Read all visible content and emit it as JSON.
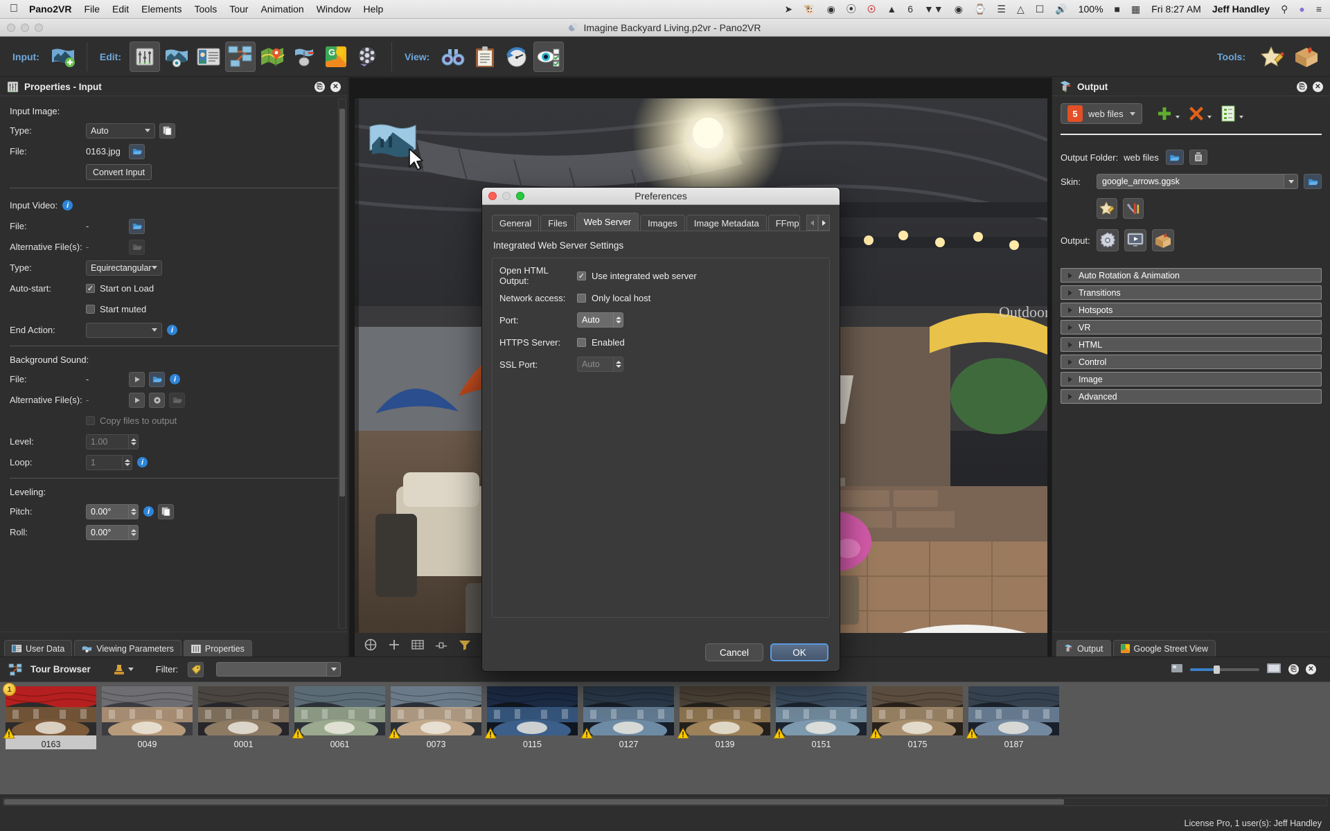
{
  "menubar": {
    "apple": "apple-logo",
    "app": "Pano2VR",
    "items": [
      "File",
      "Edit",
      "Elements",
      "Tools",
      "Tour",
      "Animation",
      "Window",
      "Help"
    ],
    "status_icons": [
      "location-arrow-icon",
      "evernote-icon",
      "skitch-icon",
      "dropbox-icon",
      "1password-icon",
      "adobe-icon",
      "textexpander-icon",
      "camera-icon",
      "timemachine-icon",
      "bluetooth-icon",
      "wifi-icon",
      "airplay-icon",
      "volume-icon"
    ],
    "adobe_count": "6",
    "battery_percent": "100%",
    "battery_icon": "battery-charging-icon",
    "clock": "Fri 8:27 AM",
    "user": "Jeff Handley",
    "search_icon": "search-icon",
    "siri_icon": "siri-icon",
    "notification_icon": "notification-center-icon"
  },
  "window": {
    "title": "Imagine Backyard Living.p2vr - Pano2VR",
    "doc_icon": "document-icon"
  },
  "toolbar": {
    "input_label": "Input:",
    "edit_label": "Edit:",
    "view_label": "View:",
    "tools_label": "Tools:",
    "input_buttons": [
      {
        "name": "open-input-icon"
      }
    ],
    "edit_buttons": [
      {
        "name": "properties-icon",
        "selected": true
      },
      {
        "name": "viewing-parameters-icon",
        "selected": false
      },
      {
        "name": "user-data-icon",
        "selected": false
      },
      {
        "name": "tour-map-icon",
        "selected": true
      },
      {
        "name": "map-editor-icon",
        "selected": false
      },
      {
        "name": "hotspot-editor-icon",
        "selected": false
      },
      {
        "name": "google-street-view-icon",
        "selected": false
      },
      {
        "name": "animation-editor-icon",
        "selected": false
      }
    ],
    "view_buttons": [
      {
        "name": "binoculars-icon",
        "selected": false
      },
      {
        "name": "clipboard-icon",
        "selected": false
      },
      {
        "name": "compass-icon",
        "selected": false
      },
      {
        "name": "visibility-icon",
        "selected": true
      }
    ],
    "tools_buttons": [
      {
        "name": "skin-editor-icon"
      },
      {
        "name": "package-icon"
      }
    ]
  },
  "left_panel": {
    "title": "Properties - Input",
    "icon": "properties-icon",
    "float_icon": "undock-icon",
    "close_icon": "close-icon",
    "sections": {
      "input_image": {
        "heading": "Input Image:",
        "type_label": "Type:",
        "type_value": "Auto",
        "file_label": "File:",
        "file_value": "0163.jpg",
        "convert_button": "Convert Input",
        "copy_icon": "copy-icon",
        "folder_icon": "folder-open-icon"
      },
      "input_video": {
        "heading": "Input Video:",
        "file_label": "File:",
        "file_value": "-",
        "alt_label": "Alternative File(s):",
        "alt_value": "-",
        "type_label": "Type:",
        "type_value": "Equirectangular",
        "autostart_label": "Auto-start:",
        "start_on_load": "Start on Load",
        "start_on_load_checked": true,
        "start_muted": "Start muted",
        "start_muted_checked": false,
        "end_action_label": "End Action:",
        "end_action_value": ""
      },
      "background_sound": {
        "heading": "Background Sound:",
        "file_label": "File:",
        "file_value": "-",
        "alt_label": "Alternative File(s):",
        "alt_value": "-",
        "copy_files": "Copy files to output",
        "copy_files_checked": false,
        "level_label": "Level:",
        "level_value": "1.00",
        "loop_label": "Loop:",
        "loop_value": "1"
      },
      "leveling": {
        "heading": "Leveling:",
        "pitch_label": "Pitch:",
        "pitch_value": "0.00°",
        "roll_label": "Roll:",
        "roll_value": "0.00°"
      }
    },
    "tabs": [
      {
        "label": "User Data",
        "icon": "user-data-icon",
        "active": false
      },
      {
        "label": "Viewing Parameters",
        "icon": "viewing-parameters-icon",
        "active": false
      },
      {
        "label": "Properties",
        "icon": "properties-icon",
        "active": true
      }
    ]
  },
  "viewer": {
    "toolbar_icons": [
      "pan-tool-icon",
      "add-point-icon",
      "grid-icon",
      "measure-icon",
      "filter-icon",
      "more-icon"
    ],
    "overlay_patch_icon": "node-marker-icon",
    "cursor_icon": "pointer-cursor"
  },
  "right_panel": {
    "title": "Output",
    "icon": "output-icon",
    "float_icon": "undock-icon",
    "close_icon": "close-icon",
    "output_type": "web files",
    "output_type_icon": "html5-icon",
    "add_icon": "add-icon",
    "remove_icon": "remove-icon",
    "duplicate_icon": "template-icon",
    "output_folder_label": "Output Folder:",
    "output_folder_value": "web files",
    "folder_icon": "folder-open-icon",
    "trash_icon": "trash-icon",
    "skin_label": "Skin:",
    "skin_value": "google_arrows.ggsk",
    "skin_edit_icon": "skin-editor-icon",
    "skin_config_icon": "skin-settings-icon",
    "output_label": "Output:",
    "output_icons": [
      "settings-gear-icon",
      "preview-icon",
      "package-icon"
    ],
    "sections": [
      "Auto Rotation & Animation",
      "Transitions",
      "Hotspots",
      "VR",
      "HTML",
      "Control",
      "Image",
      "Advanced"
    ],
    "tabs": [
      {
        "label": "Output",
        "icon": "output-icon",
        "active": true
      },
      {
        "label": "Google Street View",
        "icon": "google-street-view-icon",
        "active": false
      }
    ]
  },
  "tour_browser": {
    "title": "Tour Browser",
    "icon": "tour-browser-icon",
    "stamp_icon": "stamp-icon",
    "filter_label": "Filter:",
    "filter_value": "",
    "filter_tag_icon": "tag-icon",
    "zoom_small_icon": "small-thumbnails-icon",
    "zoom_large_icon": "large-thumbnails-icon",
    "float_icon": "undock-icon",
    "close_icon": "close-icon",
    "nodes": [
      {
        "id": "0163",
        "selected": true,
        "warning": true,
        "badge": "1"
      },
      {
        "id": "0049",
        "selected": false,
        "warning": false,
        "badge": null
      },
      {
        "id": "0001",
        "selected": false,
        "warning": false,
        "badge": null
      },
      {
        "id": "0061",
        "selected": false,
        "warning": true,
        "badge": null
      },
      {
        "id": "0073",
        "selected": false,
        "warning": true,
        "badge": null
      },
      {
        "id": "0115",
        "selected": false,
        "warning": true,
        "badge": null
      },
      {
        "id": "0127",
        "selected": false,
        "warning": true,
        "badge": null
      },
      {
        "id": "0139",
        "selected": false,
        "warning": true,
        "badge": null
      },
      {
        "id": "0151",
        "selected": false,
        "warning": true,
        "badge": null
      },
      {
        "id": "0175",
        "selected": false,
        "warning": true,
        "badge": null
      },
      {
        "id": "0187",
        "selected": false,
        "warning": true,
        "badge": null
      }
    ]
  },
  "statusbar": {
    "license": "License Pro, 1 user(s): Jeff Handley"
  },
  "preferences": {
    "title": "Preferences",
    "tabs": [
      {
        "label": "General",
        "active": false
      },
      {
        "label": "Files",
        "active": false
      },
      {
        "label": "Web Server",
        "active": true
      },
      {
        "label": "Images",
        "active": false
      },
      {
        "label": "Image Metadata",
        "active": false
      },
      {
        "label": "FFmpeg",
        "active": false
      }
    ],
    "tab_prev_icon": "chevron-left-icon",
    "tab_next_icon": "chevron-right-icon",
    "section_title": "Integrated Web Server Settings",
    "rows": [
      {
        "label": "Open HTML Output:",
        "control": "checkbox",
        "text": "Use integrated web server",
        "checked": true,
        "disabled": false
      },
      {
        "label": "Network access:",
        "control": "checkbox",
        "text": "Only local host",
        "checked": false,
        "disabled": false
      },
      {
        "label": "Port:",
        "control": "spinbox",
        "value": "Auto",
        "disabled": false
      },
      {
        "label": "HTTPS Server:",
        "control": "checkbox",
        "text": "Enabled",
        "checked": false,
        "disabled": false
      },
      {
        "label": "SSL Port:",
        "control": "spinbox",
        "value": "Auto",
        "disabled": true
      }
    ],
    "cancel": "Cancel",
    "ok": "OK"
  },
  "colors": {
    "accent_blue": "#6fa8dc",
    "panel_bg": "#2e2e2e",
    "dialog_bg": "#3a3a3a",
    "ok_border": "#5b9ae0",
    "html5_orange": "#e34f26",
    "warning_yellow": "#ffcc00"
  }
}
